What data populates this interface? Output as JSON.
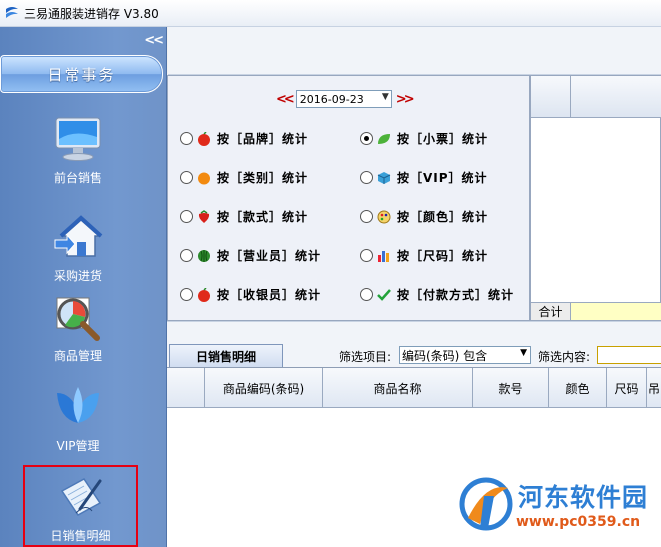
{
  "app": {
    "title": "三易通服装进销存 V3.80"
  },
  "sidebar": {
    "collapse_label": "<<",
    "section_label": "日常事务",
    "items": [
      {
        "label": "前台销售",
        "icon": "monitor-icon"
      },
      {
        "label": "采购进货",
        "icon": "house-arrow-icon"
      },
      {
        "label": "商品管理",
        "icon": "magnifier-chart-icon"
      },
      {
        "label": "VIP管理",
        "icon": "butterfly-icon"
      },
      {
        "label": "日销售明细",
        "icon": "document-pen-icon",
        "selected": true
      }
    ]
  },
  "date": {
    "prev": "<<",
    "value": "2016-09-23",
    "next": ">>"
  },
  "stat_options": [
    {
      "label": "按［品牌］统计",
      "icon": "apple-icon",
      "checked": false
    },
    {
      "label": "按［小票］统计",
      "icon": "leaf-icon",
      "checked": true
    },
    {
      "label": "按［类别］统计",
      "icon": "orange-icon",
      "checked": false
    },
    {
      "label": "按［VIP］统计",
      "icon": "cube-icon",
      "checked": false
    },
    {
      "label": "按［款式］统计",
      "icon": "strawberry-icon",
      "checked": false
    },
    {
      "label": "按［颜色］统计",
      "icon": "palette-icon",
      "checked": false
    },
    {
      "label": "按［营业员］统计",
      "icon": "watermelon-icon",
      "checked": false
    },
    {
      "label": "按［尺码］统计",
      "icon": "bar-chart-icon",
      "checked": false
    },
    {
      "label": "按［收银员］统计",
      "icon": "apple-icon",
      "checked": false
    },
    {
      "label": "按［付款方式］统计",
      "icon": "check-icon",
      "checked": false
    }
  ],
  "right_grid": {
    "footer_label": "合计"
  },
  "detail": {
    "tab_label": "日销售明细",
    "filter_item_label": "筛选项目:",
    "filter_item_value": "编码(条码) 包含",
    "filter_content_label": "筛选内容:",
    "filter_content_value": "",
    "columns": [
      "商品编码(条码)",
      "商品名称",
      "款号",
      "颜色",
      "尺码",
      "吊"
    ]
  },
  "watermark": {
    "name": "河东软件园",
    "url": "www.pc0359.cn"
  },
  "colors": {
    "sidebar": "#6f93c8",
    "accent_red": "#c00000",
    "selected_border": "#e60012"
  }
}
